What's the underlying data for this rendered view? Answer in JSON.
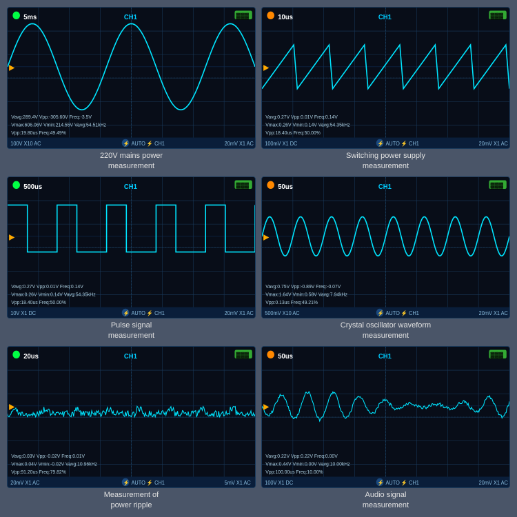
{
  "panels": [
    {
      "id": "panel1",
      "timeDiv": "5ms",
      "channel": "CH1",
      "captionLine1": "220V mains power",
      "captionLine2": "measurement",
      "stats": "Vavg:289.4V  Vpp:-305.60V  Freq:-3.5V\nVmax:606.06V  Vmin:214.55V  Vavg:54.51kHz\nVpp:19.80us  Freq:49.49%",
      "footerLeft": "100V  X10  AC",
      "footerRight": "20mV  X1  AC",
      "waveType": "sine",
      "dotColor": "green"
    },
    {
      "id": "panel2",
      "timeDiv": "10us",
      "channel": "CH1",
      "captionLine1": "Switching power supply",
      "captionLine2": "measurement",
      "stats": "Vavg:0.27V  Vpp:0.01V  Freq:0.14V\nVmax:0.26V  Vmin:0.14V  Vavg:54.35kHz\nVpp:18.40us  Freq:50.00%",
      "footerLeft": "100mV  X1  DC",
      "footerRight": "20mV  X1  AC",
      "waveType": "sawtooth",
      "dotColor": "orange"
    },
    {
      "id": "panel3",
      "timeDiv": "500us",
      "channel": "CH1",
      "captionLine1": "Pulse signal",
      "captionLine2": "measurement",
      "stats": "Vavg:0.27V  Vpp:0.01V  Freq:0.14V\nVmax:0.26V  Vmin:0.14V  Vavg:54.35kHz\nVpp:18.40us  Freq:50.00%",
      "footerLeft": "10V  X1  DC",
      "footerRight": "20mV  X1  AC",
      "waveType": "pulse",
      "dotColor": "green"
    },
    {
      "id": "panel4",
      "timeDiv": "50us",
      "channel": "CH1",
      "captionLine1": "Crystal oscillator waveform",
      "captionLine2": "measurement",
      "stats": "Vavg:0.75V  Vpp:-0.89V  Freq:-0.07V\nVmax:1.64V  Vmin:0.58V  Vavg:7.94kHz\nVpp:0.13us  Freq:49.21%",
      "footerLeft": "500mV  X10  AC",
      "footerRight": "20mV  X1  AC",
      "waveType": "sine_multi",
      "dotColor": "orange"
    },
    {
      "id": "panel5",
      "timeDiv": "20us",
      "channel": "CH1",
      "captionLine1": "Measurement of",
      "captionLine2": "power ripple",
      "stats": "Vavg:0.03V  Vpp:-0.02V  Freq:0.01V\nVmax:0.04V  Vmin:-0.02V  Vavg:10.96kHz\nVpp:91.20us  Freq:79.82%",
      "footerLeft": "20mV  X1  AC",
      "footerRight": "5mV  X1  AC",
      "waveType": "ecg",
      "dotColor": "green"
    },
    {
      "id": "panel6",
      "timeDiv": "50us",
      "channel": "CH1",
      "captionLine1": "Audio signal",
      "captionLine2": "measurement",
      "stats": "Vavg:0.22V  Vpp:0.22V  Freq:0.00V\nVmax:0.44V  Vmin:0.00V  Vavg:10.00kHz\nVpp:100.00us  Freq:10.00%",
      "footerLeft": "100V  X1  DC",
      "footerRight": "20mV  X1  AC",
      "waveType": "audio",
      "dotColor": "orange"
    }
  ]
}
